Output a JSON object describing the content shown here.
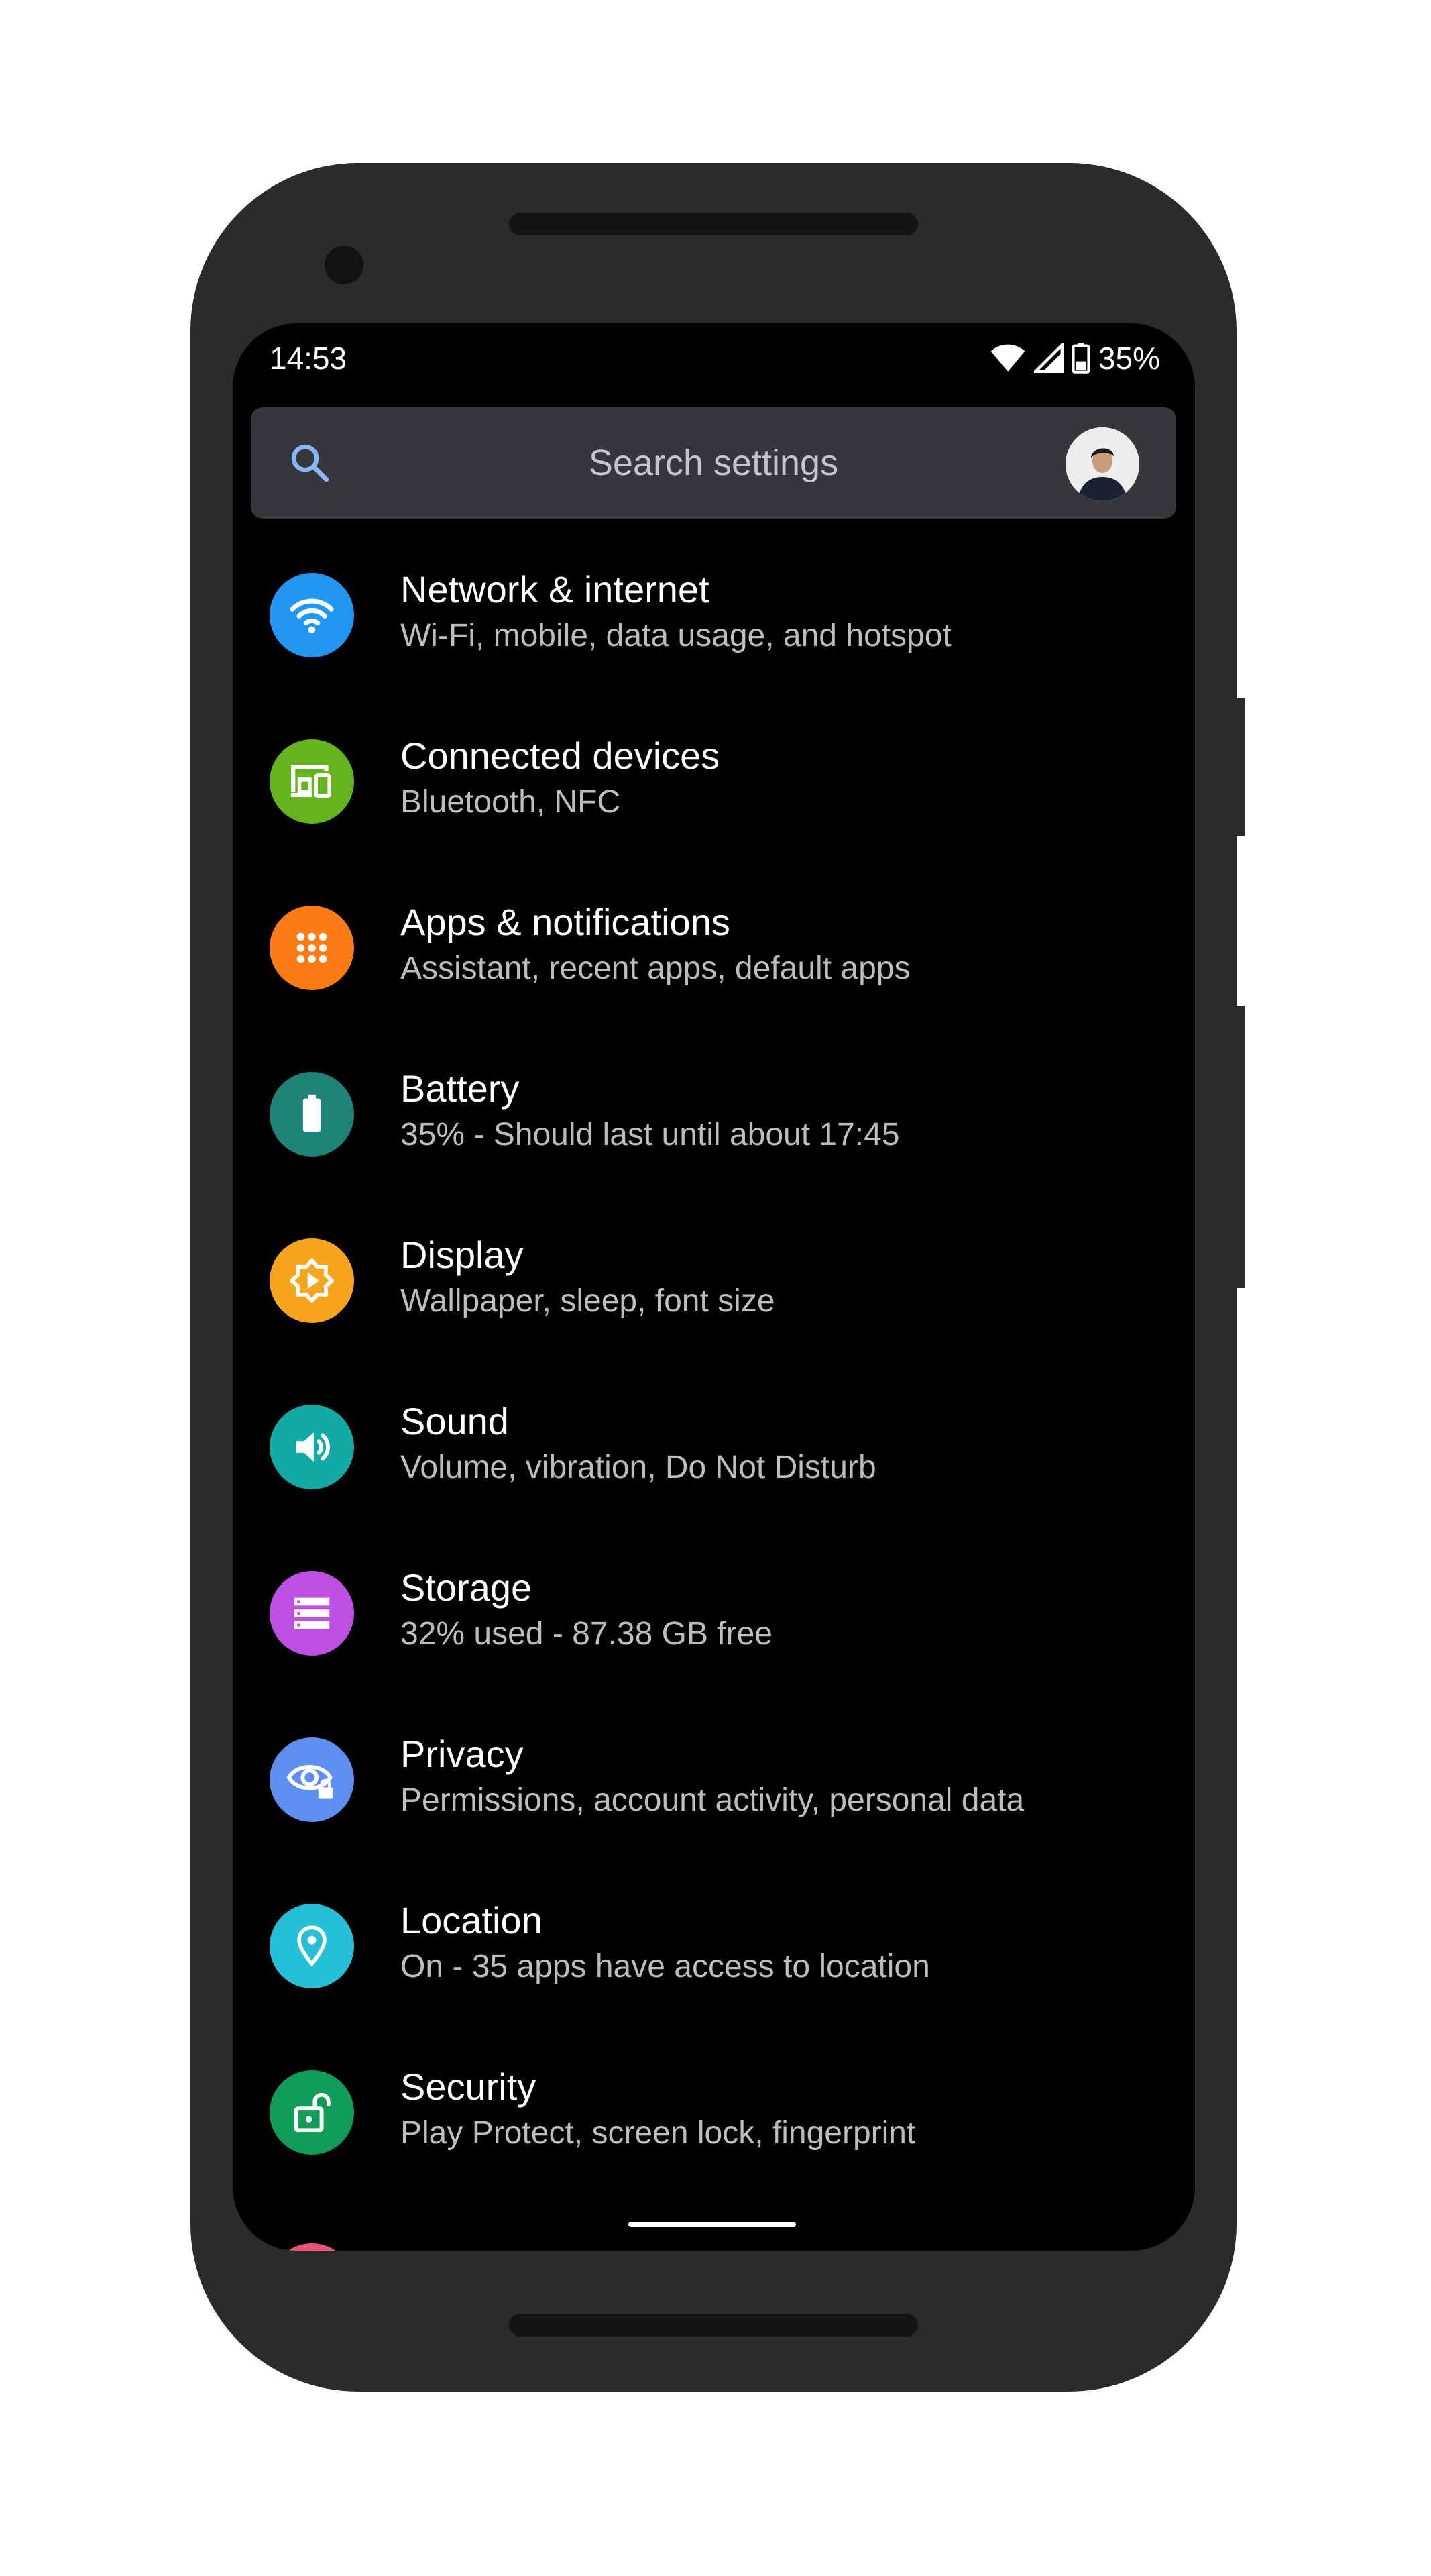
{
  "status_bar": {
    "time": "14:53",
    "battery_percent": "35%"
  },
  "search": {
    "placeholder": "Search settings"
  },
  "settings": [
    {
      "title": "Network & internet",
      "subtitle": "Wi-Fi, mobile, data usage, and hotspot",
      "icon": "wifi-icon",
      "color": "#2196f3"
    },
    {
      "title": "Connected devices",
      "subtitle": "Bluetooth, NFC",
      "icon": "devices-icon",
      "color": "#64b41e"
    },
    {
      "title": "Apps & notifications",
      "subtitle": "Assistant, recent apps, default apps",
      "icon": "apps-grid-icon",
      "color": "#fb7b15"
    },
    {
      "title": "Battery",
      "subtitle": "35% - Should last until about 17:45",
      "icon": "battery-icon",
      "color": "#1f8378"
    },
    {
      "title": "Display",
      "subtitle": "Wallpaper, sleep, font size",
      "icon": "brightness-icon",
      "color": "#f8a41c"
    },
    {
      "title": "Sound",
      "subtitle": "Volume, vibration, Do Not Disturb",
      "icon": "volume-icon",
      "color": "#12aaa4"
    },
    {
      "title": "Storage",
      "subtitle": "32% used - 87.38 GB free",
      "icon": "storage-icon",
      "color": "#bf50e4"
    },
    {
      "title": "Privacy",
      "subtitle": "Permissions, account activity, personal data",
      "icon": "privacy-eye-icon",
      "color": "#5e8ef0"
    },
    {
      "title": "Location",
      "subtitle": "On - 35 apps have access to location",
      "icon": "location-pin-icon",
      "color": "#25c0d8"
    },
    {
      "title": "Security",
      "subtitle": "Play Protect, screen lock, fingerprint",
      "icon": "unlocked-padlock-icon",
      "color": "#109d58"
    }
  ]
}
